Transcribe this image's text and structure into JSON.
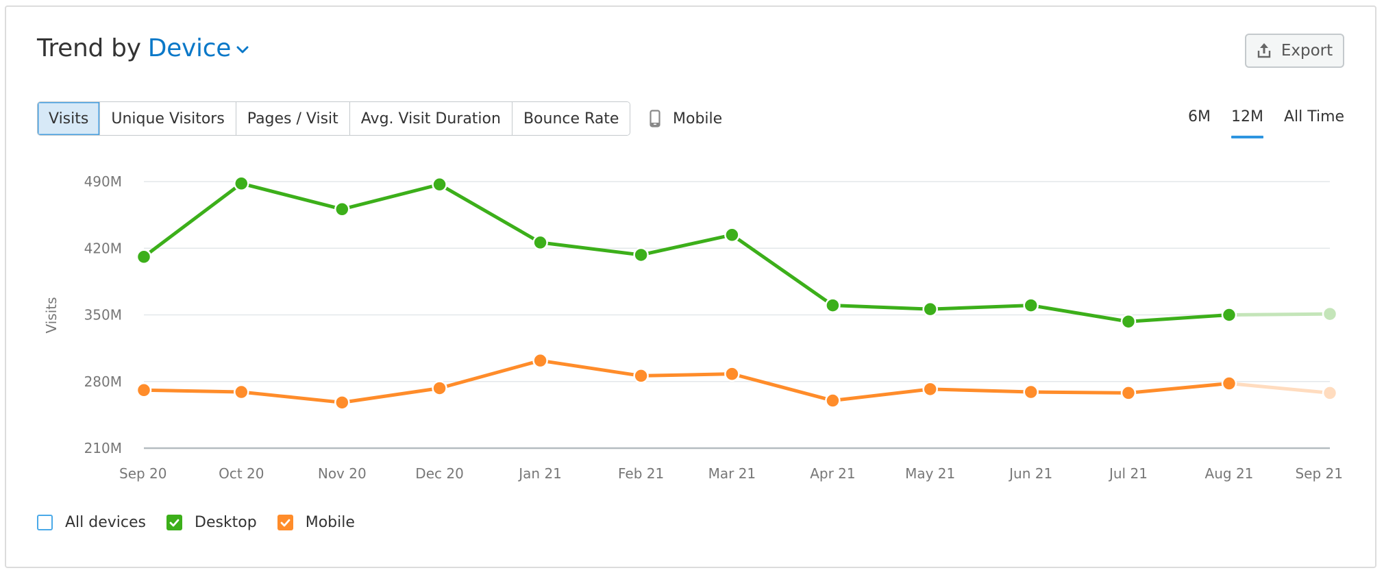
{
  "header": {
    "title_static": "Trend by",
    "title_dropdown": "Device",
    "export_label": "Export"
  },
  "metric_tabs": [
    {
      "label": "Visits",
      "active": true
    },
    {
      "label": "Unique Visitors",
      "active": false
    },
    {
      "label": "Pages / Visit",
      "active": false
    },
    {
      "label": "Avg. Visit Duration",
      "active": false
    },
    {
      "label": "Bounce Rate",
      "active": false
    }
  ],
  "device_filter": {
    "label": "Mobile",
    "icon": "mobile-phone-icon"
  },
  "period_tabs": [
    {
      "label": "6M",
      "active": false
    },
    {
      "label": "12M",
      "active": true
    },
    {
      "label": "All Time",
      "active": false
    }
  ],
  "legend": [
    {
      "label": "All devices",
      "checked": false,
      "color": "#4aa9e8"
    },
    {
      "label": "Desktop",
      "checked": true,
      "color": "#3caf1a"
    },
    {
      "label": "Mobile",
      "checked": true,
      "color": "#ff8c2a"
    }
  ],
  "colors": {
    "desktop": "#3caf1a",
    "desktop_faded": "#c4e5b9",
    "mobile": "#ff8c2a",
    "mobile_faded": "#ffdcbf",
    "accent": "#0a78c8",
    "grid": "#e3e7ea",
    "axis": "#b4bcc0"
  },
  "chart_data": {
    "type": "line",
    "title": "Trend by Device",
    "xlabel": "",
    "ylabel": "Visits",
    "categories": [
      "Sep 20",
      "Oct 20",
      "Nov 20",
      "Dec 20",
      "Jan 21",
      "Feb 21",
      "Mar 21",
      "Apr 21",
      "May 21",
      "Jun 21",
      "Jul 21",
      "Aug 21",
      "Sep 21"
    ],
    "x_days": [
      0,
      30,
      61,
      91,
      122,
      153,
      181,
      212,
      242,
      273,
      303,
      334,
      365
    ],
    "yticks": [
      210,
      280,
      350,
      420,
      490
    ],
    "ytick_labels": [
      "210M",
      "280M",
      "350M",
      "420M",
      "490M"
    ],
    "ylim": [
      210,
      490
    ],
    "y_unit": "M",
    "grid": true,
    "legend_position": "bottom-left",
    "series": [
      {
        "name": "Desktop",
        "values": [
          411,
          488,
          461,
          487,
          426,
          413,
          434,
          360,
          356,
          360,
          343,
          350,
          351
        ],
        "partial_last": true
      },
      {
        "name": "Mobile",
        "values": [
          271,
          269,
          258,
          273,
          302,
          286,
          288,
          260,
          272,
          269,
          268,
          278,
          268
        ],
        "partial_last": true
      }
    ],
    "hidden_series": [
      "All devices"
    ]
  }
}
